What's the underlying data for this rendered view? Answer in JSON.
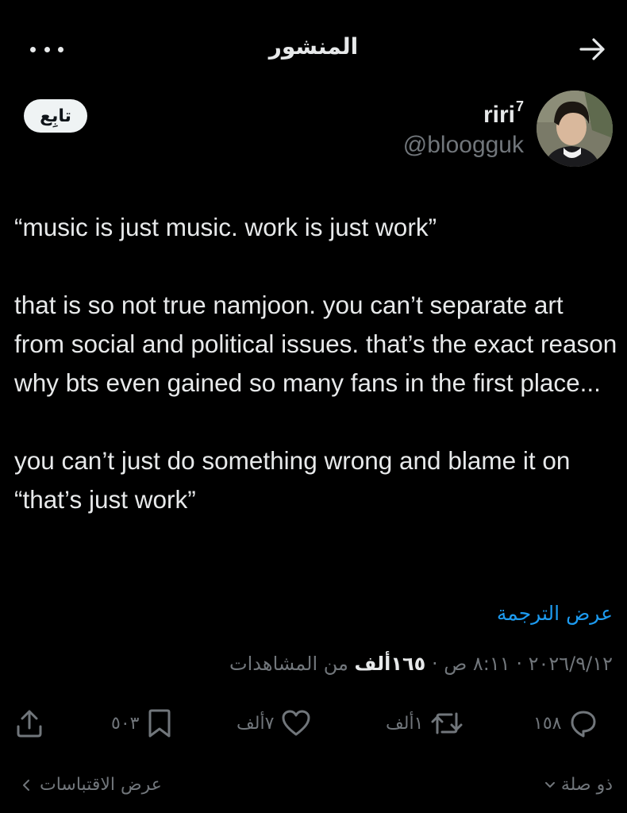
{
  "header": {
    "title": "المنشور"
  },
  "author": {
    "display_name": "riri",
    "display_name_sup": "7",
    "handle": "@bloogguk",
    "follow_label": "تابِع"
  },
  "tweet": {
    "paragraphs": [
      "“music is just music. work is just work”",
      "that is so not true namjoon. you can’t separate art from social and political issues. that’s the exact reason why bts even gained so many fans in the first place...",
      "you can’t just do something wrong and blame it on “that’s just work”"
    ],
    "translate_label": "عرض الترجمة"
  },
  "meta": {
    "date": "٢٠٢٦/٩/١٢",
    "separator": "·",
    "time": "٨:١١ ص",
    "views_count": "١٦٥ألف",
    "views_label": "من المشاهدات"
  },
  "actions": {
    "replies": "١٥٨",
    "reposts": "١ألف",
    "likes": "٧ألف",
    "bookmarks": "٥٠٣"
  },
  "footer": {
    "relevance_label": "ذو صلة",
    "quotes_label": "عرض الاقتباسات"
  },
  "colors": {
    "background": "#000000",
    "text": "#e7e9ea",
    "muted": "#71767b",
    "accent": "#1d9bf0"
  }
}
